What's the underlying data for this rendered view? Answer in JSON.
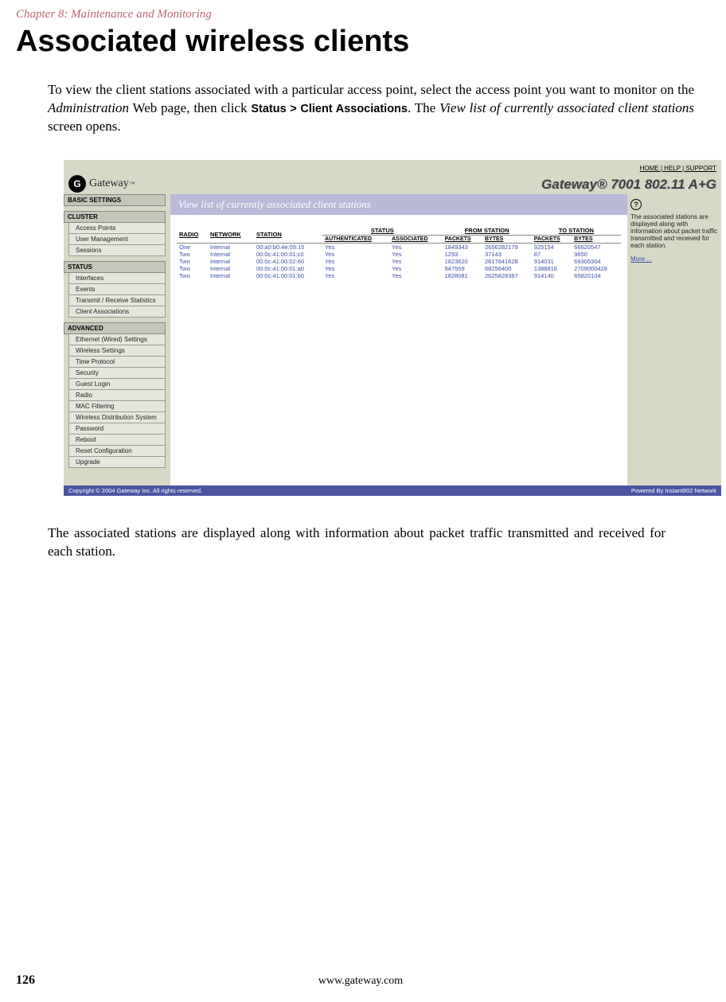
{
  "document": {
    "chapter_header": "Chapter 8: Maintenance and Monitoring",
    "title": "Associated wireless clients",
    "intro_p1_a": "To view the client stations associated with a particular access point, select the access point you want to monitor on the ",
    "intro_p1_admin": "Administration",
    "intro_p1_b": " Web page, then click ",
    "intro_p1_nav": "Status > Client Associations",
    "intro_p1_c": ". The ",
    "intro_p1_screen": "View list of currently associated client stations",
    "intro_p1_d": " screen opens.",
    "closing": "The associated stations are displayed along with information about packet traffic transmitted and received for each station.",
    "page_number": "126",
    "page_url": "www.gateway.com"
  },
  "screenshot": {
    "logo_text": "Gateway",
    "toplinks": [
      "HOME",
      "HELP",
      "SUPPORT"
    ],
    "product": "Gateway® 7001 802.11 A+G",
    "nav": {
      "basic": {
        "heading": "BASIC SETTINGS"
      },
      "cluster": {
        "heading": "CLUSTER",
        "items": [
          "Access Points",
          "User Management",
          "Sessions"
        ]
      },
      "status": {
        "heading": "STATUS",
        "items": [
          "Interfaces",
          "Events",
          "Transmit / Receive Statistics",
          "Client Associations"
        ]
      },
      "advanced": {
        "heading": "ADVANCED",
        "items": [
          "Ethernet (Wired) Settings",
          "Wireless Settings",
          "Time Protocol",
          "Security",
          "Guest Login",
          "Radio",
          "MAC Filtering",
          "Wireless Distribution System",
          "Password",
          "Reboot",
          "Reset Configuration",
          "Upgrade"
        ]
      }
    },
    "main_header": "View list of currently associated client stations",
    "table": {
      "top_headers": [
        "RADIO",
        "NETWORK",
        "STATION",
        "STATUS",
        "FROM STATION",
        "TO STATION"
      ],
      "sub_headers": [
        "",
        "",
        "",
        "AUTHENTICATED",
        "ASSOCIATED",
        "PACKETS",
        "BYTES",
        "PACKETS",
        "BYTES"
      ],
      "rows": [
        {
          "radio": "One",
          "network": "Internal",
          "station": "00:a0:b0:4e:05:15",
          "auth": "Yes",
          "assoc": "Yes",
          "fp": "1849343",
          "fb": "2656282179",
          "tp": "925154",
          "tb": "66620547"
        },
        {
          "radio": "Two",
          "network": "Internal",
          "station": "00:0c:41:00:01:c0",
          "auth": "Yes",
          "assoc": "Yes",
          "fp": "1293",
          "fb": "37143",
          "tp": "87",
          "tb": "9650"
        },
        {
          "radio": "Two",
          "network": "Internal",
          "station": "00:0c:41:00:02:60",
          "auth": "Yes",
          "assoc": "Yes",
          "fp": "1823620",
          "fb": "2617641628",
          "tp": "914031",
          "tb": "69305304"
        },
        {
          "radio": "Two",
          "network": "Internal",
          "station": "00:0c:41:00:01:a0",
          "auth": "Yes",
          "assoc": "Yes",
          "fp": "947559",
          "fb": "68256400",
          "tp": "1388816",
          "tb": "2709000428"
        },
        {
          "radio": "Two",
          "network": "Internal",
          "station": "00:0c:41:00:01:b0",
          "auth": "Yes",
          "assoc": "Yes",
          "fp": "1828081",
          "fb": "2625828387",
          "tp": "914140",
          "tb": "65820104"
        }
      ]
    },
    "help": {
      "text": "The associated stations are displayed along with information about packet traffic transmitted and received for each station.",
      "more": "More ..."
    },
    "footer": {
      "copyright": "Copyright © 2004 Gateway Inc. All rights reserved.",
      "powered": "Powered By Instant802 Network"
    }
  }
}
